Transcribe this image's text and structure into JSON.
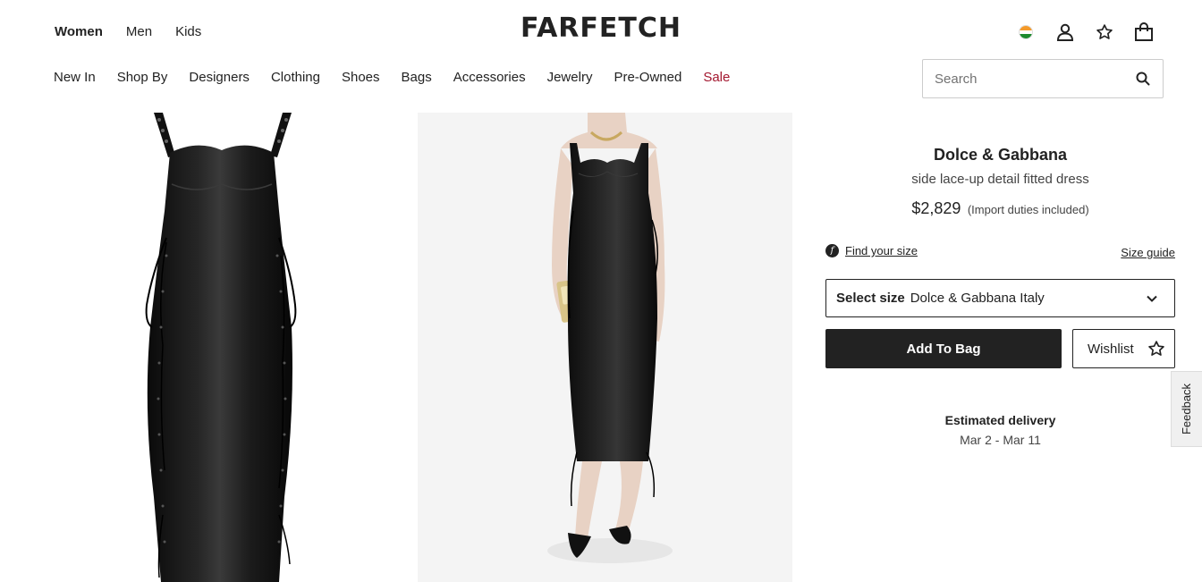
{
  "header": {
    "gender_tabs": [
      {
        "label": "Women",
        "active": true
      },
      {
        "label": "Men",
        "active": false
      },
      {
        "label": "Kids",
        "active": false
      }
    ],
    "logo": "FARFETCH",
    "icons": [
      "india-flag-icon",
      "account-icon",
      "wishlist-star-icon",
      "shopping-bag-icon"
    ]
  },
  "nav": {
    "items": [
      "New In",
      "Shop By",
      "Designers",
      "Clothing",
      "Shoes",
      "Bags",
      "Accessories",
      "Jewelry",
      "Pre-Owned",
      "Sale"
    ]
  },
  "search": {
    "placeholder": "Search",
    "value": ""
  },
  "product": {
    "brand": "Dolce & Gabbana",
    "name": "side lace-up detail fitted dress",
    "price": "$2,829",
    "duties": "(Import duties included)",
    "find_size": "Find your size",
    "size_guide": "Size guide",
    "select_label": "Select size",
    "select_value": "Dolce & Gabbana Italy",
    "add_to_bag": "Add To Bag",
    "wishlist": "Wishlist",
    "delivery_title": "Estimated delivery",
    "delivery_dates": "Mar 2 - Mar 11"
  },
  "feedback": "Feedback",
  "colors": {
    "text": "#222222",
    "sale": "#a3172f",
    "button_bg": "#222222"
  }
}
